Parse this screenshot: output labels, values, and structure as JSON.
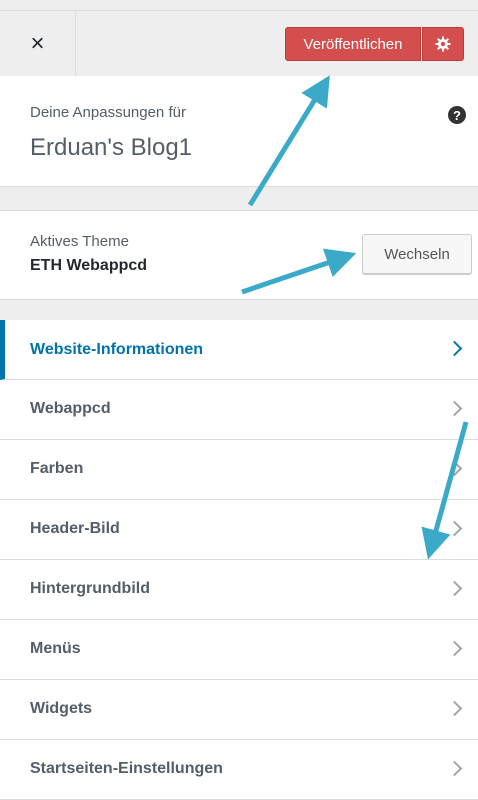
{
  "header": {
    "close_glyph": "×",
    "publish_label": "Veröffentlichen",
    "settings_icon": "gear-icon"
  },
  "info": {
    "label": "Deine Anpassungen für",
    "title": "Erduan's Blog1",
    "help_glyph": "?"
  },
  "theme": {
    "label": "Aktives Theme",
    "name": "ETH Webappcd",
    "switch_label": "Wechseln"
  },
  "menu": {
    "items": [
      {
        "label": "Website-Informationen"
      },
      {
        "label": "Webappcd"
      },
      {
        "label": "Farben"
      },
      {
        "label": "Header-Bild"
      },
      {
        "label": "Hintergrundbild"
      },
      {
        "label": "Menüs"
      },
      {
        "label": "Widgets"
      },
      {
        "label": "Startseiten-Einstellungen"
      }
    ]
  },
  "colors": {
    "publish": "#d54e4e",
    "accent": "#0073aa",
    "annotation_arrow": "#3aaac8"
  }
}
